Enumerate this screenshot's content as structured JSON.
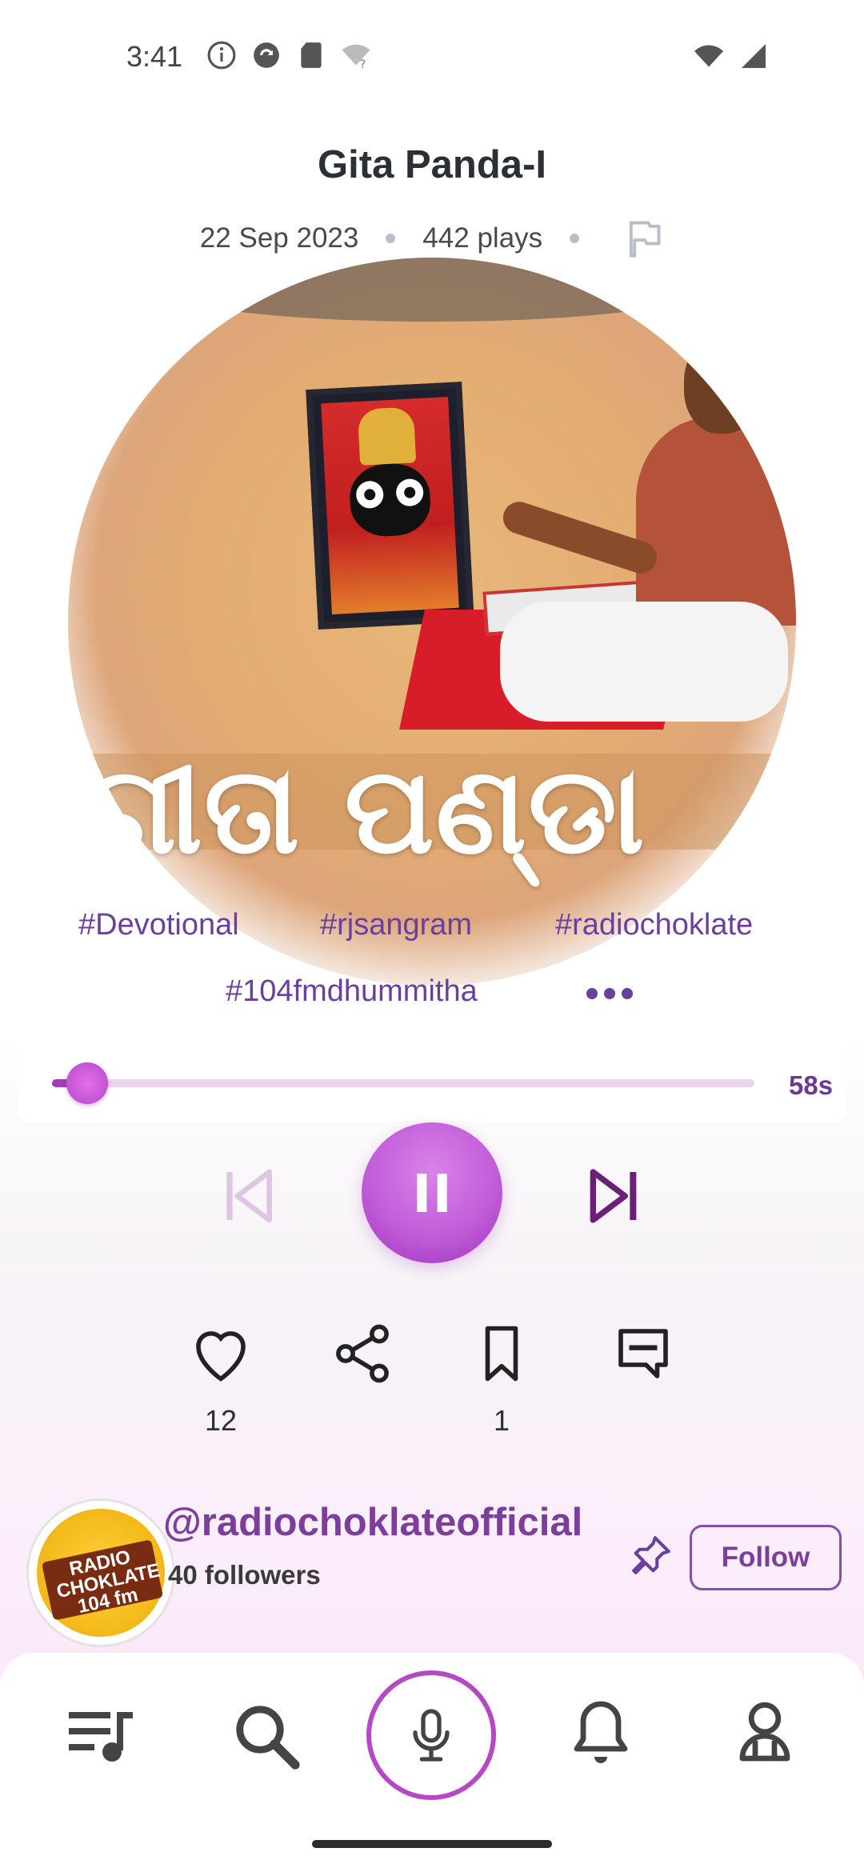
{
  "status_bar": {
    "time": "3:41",
    "icons": [
      "info-icon",
      "sync-icon",
      "sd-card-icon",
      "wifi-question-icon"
    ],
    "right_icons": [
      "wifi-icon",
      "signal-icon"
    ]
  },
  "track": {
    "title": "Gita Panda-I",
    "date": "22 Sep 2023",
    "plays": "442 plays",
    "artwork_text": "ଗୀତା ପଣ୍ଡା"
  },
  "tags": [
    "#Devotional",
    "#rjsangram",
    "#radiochoklate",
    "#104fmdhummitha"
  ],
  "player": {
    "progress_fraction": 0.05,
    "duration": "58s"
  },
  "actions": {
    "likes": "12",
    "bookmarks": "1"
  },
  "profile": {
    "handle": "@radiochoklateofficial",
    "followers": "40 followers",
    "follow_label": "Follow",
    "avatar_text": "RADIO CHOKLATE 104 fm"
  },
  "colors": {
    "accent": "#a33ab6",
    "tag_text": "#6a3fa0",
    "handle": "#7b3e9c"
  },
  "nav": [
    "playlist-icon",
    "search-icon",
    "mic-icon",
    "bell-icon",
    "profile-icon"
  ]
}
